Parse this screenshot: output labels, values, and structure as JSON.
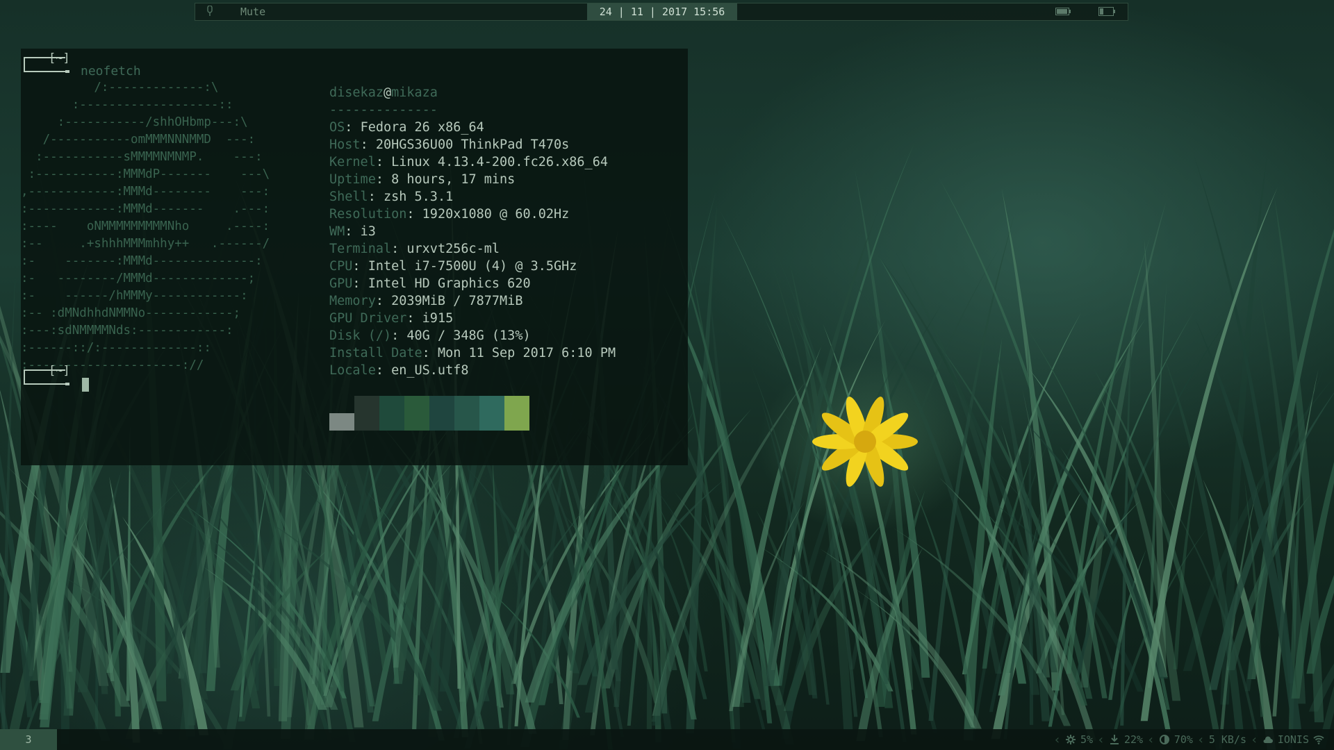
{
  "topbar": {
    "volume_label": "Mute",
    "clock": "24 | 11 | 2017 15:56"
  },
  "terminal": {
    "prompt_dir": "[~]",
    "command": "neofetch",
    "ascii_logo": [
      "          /:-------------:\\",
      "       :-------------------::",
      "     :-----------/shhOHbmp---:\\",
      "   /-----------omMMMNNNMMD  ---:",
      "  :-----------sMMMMNMNMP.    ---:",
      " :-----------:MMMdP-------    ---\\",
      ",------------:MMMd--------    ---:",
      ":------------:MMMd-------    .---:",
      ":----    oNMMMMMMMMMNho     .----:",
      ":--     .+shhhMMMmhhy++   .------/",
      ":-    -------:MMMd--------------:",
      ":-   --------/MMMd-------------;",
      ":-    ------/hMMMy------------:",
      ":-- :dMNdhhdNMMNo------------;",
      ":---:sdNMMMMNds:------------:",
      ":------::/:-------------::",
      ":---------------------://"
    ],
    "info": {
      "user": "disekaz",
      "at": "@",
      "host": "mikaza",
      "separator": "--------------",
      "rows": [
        {
          "key": "OS",
          "value": "Fedora 26 x86_64"
        },
        {
          "key": "Host",
          "value": "20HGS36U00 ThinkPad T470s"
        },
        {
          "key": "Kernel",
          "value": "Linux 4.13.4-200.fc26.x86_64"
        },
        {
          "key": "Uptime",
          "value": "8 hours, 17 mins"
        },
        {
          "key": "Shell",
          "value": "zsh 5.3.1"
        },
        {
          "key": "Resolution",
          "value": "1920x1080 @ 60.02Hz"
        },
        {
          "key": "WM",
          "value": "i3"
        },
        {
          "key": "Terminal",
          "value": "urxvt256c-ml"
        },
        {
          "key": "CPU",
          "value": "Intel i7-7500U (4) @ 3.5GHz"
        },
        {
          "key": "GPU",
          "value": "Intel HD Graphics 620"
        },
        {
          "key": "Memory",
          "value": "2039MiB / 7877MiB"
        },
        {
          "key": "GPU Driver",
          "value": "i915"
        },
        {
          "key": "Disk (/)",
          "value": "40G / 348G (13%)"
        },
        {
          "key": "Install Date",
          "value": "Mon 11 Sep 2017 6:10 PM"
        },
        {
          "key": "Locale",
          "value": "en_US.utf8"
        }
      ]
    },
    "palette": [
      "#7c8883",
      "#26352e",
      "#1f4a3b",
      "#2a5a3a",
      "#1f453f",
      "#27564a",
      "#2f6a5e",
      "#7fa64e"
    ]
  },
  "bottombar": {
    "workspace": "3",
    "status": [
      {
        "icon": "gear-icon",
        "text": "5%"
      },
      {
        "icon": "download-icon",
        "text": "22%"
      },
      {
        "icon": "brightness-icon",
        "text": "70%"
      },
      {
        "icon": "",
        "text": "5 KB/s"
      },
      {
        "icon": "cloud-icon",
        "text": "IONIS"
      },
      {
        "icon": "wifi-icon",
        "text": ""
      }
    ]
  }
}
